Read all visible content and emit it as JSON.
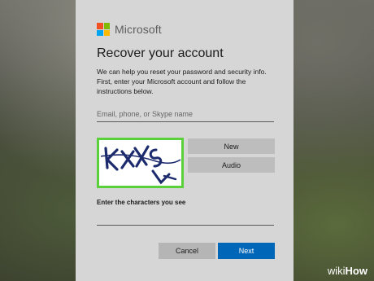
{
  "brand": {
    "name": "Microsoft"
  },
  "page": {
    "title": "Recover your account",
    "description": "We can help you reset your password and security info. First, enter your Microsoft account and follow the instructions below."
  },
  "account_field": {
    "placeholder": "Email, phone, or Skype name",
    "value": ""
  },
  "captcha": {
    "image_icon": "captcha-image-icon",
    "new_label": "New",
    "audio_label": "Audio",
    "prompt": "Enter the characters you see",
    "value": "",
    "highlight_color": "#5ad13a"
  },
  "actions": {
    "cancel_label": "Cancel",
    "next_label": "Next"
  },
  "colors": {
    "accent": "#0067b8",
    "panel": "#d6d6d6"
  },
  "watermark": {
    "part1": "wiki",
    "part2": "How"
  }
}
